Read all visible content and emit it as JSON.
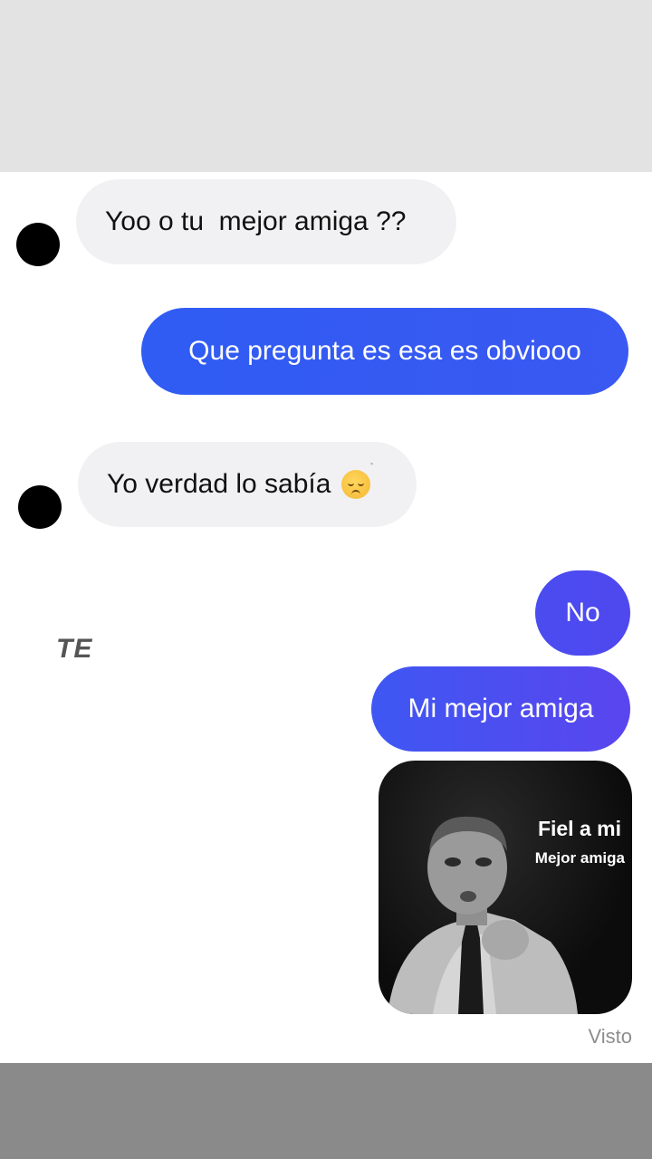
{
  "messages": [
    {
      "direction": "incoming",
      "text": "Yoo o tu  mejor amiga ??"
    },
    {
      "direction": "outgoing",
      "text": "Que pregunta es esa es obviooo"
    },
    {
      "direction": "incoming",
      "text": "Yo verdad lo sabía",
      "emoji": "relieved-face-emoji"
    },
    {
      "direction": "outgoing",
      "text": "No"
    },
    {
      "direction": "outgoing",
      "text": "Mi mejor amiga"
    }
  ],
  "image_message": {
    "caption_line1": "Fiel a mi",
    "caption_line2": "Mejor amiga"
  },
  "side_text": "TE",
  "status": {
    "seen_label": "Visto"
  },
  "colors": {
    "outgoing_bubble_start": "#2f5cf3",
    "outgoing_bubble_end": "#5046ee",
    "incoming_bubble": "#f1f1f3",
    "avatar": "#000000"
  }
}
